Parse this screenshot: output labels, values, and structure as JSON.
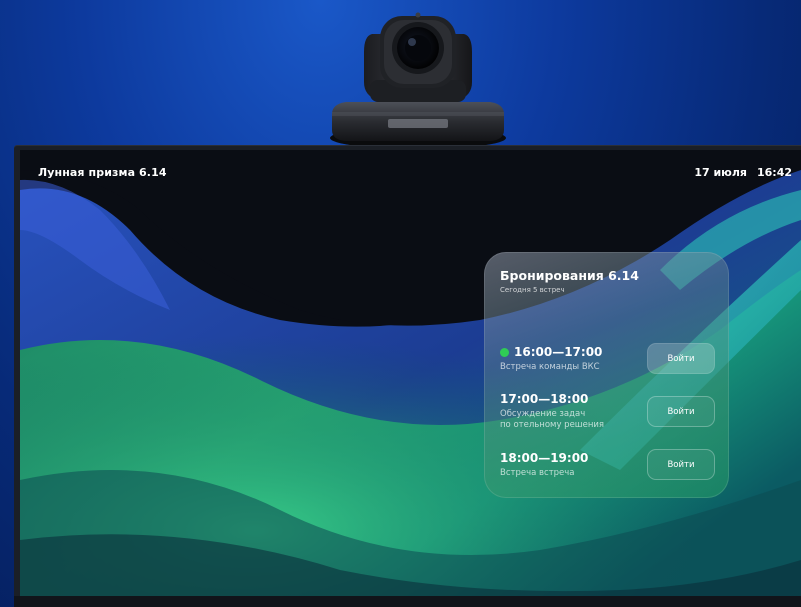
{
  "screen": {
    "room_name": "Лунная призма 6.14",
    "date": "17 июля",
    "time": "16:42"
  },
  "booking_panel": {
    "title": "Бронирования 6.14",
    "subtitle": "Сегодня 5 встреч",
    "meetings": [
      {
        "time": "16:00—17:00",
        "title": "Встреча команды ВКС",
        "join_label": "Войти",
        "status": "in-progress",
        "status_color": "#2fcc55"
      },
      {
        "time": "17:00—18:00",
        "title_line1": "Обсуждение задач",
        "title_line2": "по отельному решения",
        "join_label": "Войти"
      },
      {
        "time": "18:00—19:00",
        "title": "Встреча встреча",
        "join_label": "Войти"
      }
    ]
  },
  "colors": {
    "background": "#0d3a9e",
    "accent_green": "#2fcc55",
    "text": "#ffffff"
  },
  "icons": {
    "camera": "ptz-camera-icon"
  }
}
